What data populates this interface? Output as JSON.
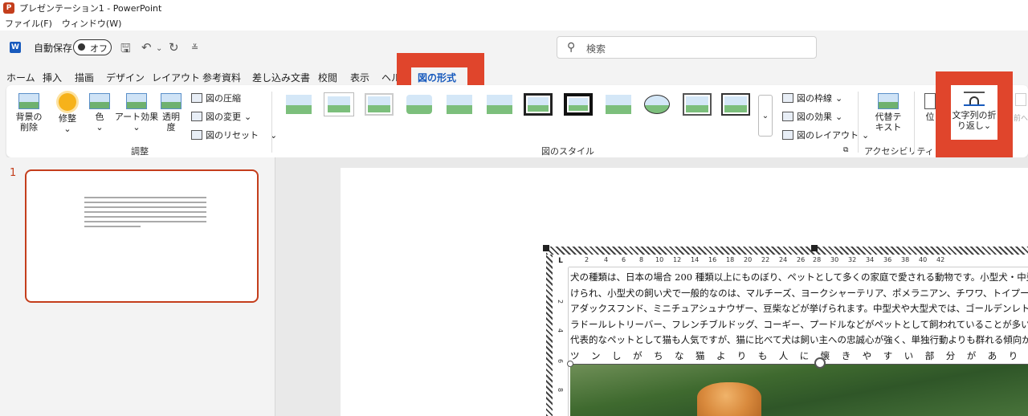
{
  "title_bar": {
    "app_icon": "P",
    "title": "プレゼンテーション1 - PowerPoint"
  },
  "menu": [
    "ファイル(F)",
    "ウィンドウ(W)"
  ],
  "qat": {
    "word_icon": "W",
    "autosave_label": "自動保存",
    "toggle_label": "オフ",
    "icons": [
      "save-icon",
      "undo-icon",
      "redo-icon",
      "customize-icon"
    ]
  },
  "search": {
    "placeholder": "検索"
  },
  "tabs": [
    "ホーム",
    "挿入",
    "描画",
    "デザイン",
    "レイアウト",
    "参考資料",
    "差し込み文書",
    "校閲",
    "表示",
    "ヘル",
    "図の形式"
  ],
  "active_tab": "図の形式",
  "ribbon": {
    "adjust": {
      "remove_bg": "背景の\n削除",
      "corrections": "修整",
      "color": "色",
      "art_effects": "アート効果",
      "transparency": "透明\n度",
      "compress": "図の圧縮",
      "change": "図の変更",
      "reset": "図のリセット",
      "group_label": "調整"
    },
    "styles": {
      "group_label": "図のスタイル",
      "border": "図の枠線",
      "effects": "図の効果",
      "layout": "図のレイアウト"
    },
    "accessibility": {
      "alt_text": "代替テ\nキスト",
      "group_label": "アクセシビリティ"
    },
    "arrange": {
      "position": "位",
      "wrap_text": "文字列の折\nり返し",
      "forward": "前へ"
    }
  },
  "slides_pane": {
    "slide_number": "1"
  },
  "document": {
    "ruler_corner": "L",
    "ruler_ticks": [
      "2",
      "4",
      "6",
      "8",
      "10",
      "12",
      "14",
      "16",
      "18",
      "20",
      "22",
      "24",
      "26",
      "28",
      "30",
      "32",
      "34",
      "36",
      "38",
      "40",
      "42"
    ],
    "ruler_left_ticks": [
      "2",
      "4",
      "6",
      "8"
    ],
    "lines": [
      "犬の種類は、日本の場合 200 種類以上にものぼり、ペットとして多くの家庭で愛される動物です。小型犬・中型犬・",
      "けられ、小型犬の飼い犬で一般的なのは、マルチーズ、ヨークシャーテリア、ポメラニアン、チワワ、トイプードル",
      "アダックスフンド、ミニチュアシュナウザー、豆柴などが挙げられます。中型犬や大型犬では、ゴールデンレトリー",
      "ラドールレトリーバー、フレンチブルドッグ、コーギー、プードルなどがペットとして飼われていることが多いです",
      "代表的なペットとして猫も人気ですが、猫に比べて犬は飼い主への忠誠心が強く、単独行動よりも群れる傾向がある",
      "ツンしがちな猫よりも人に懐きやすい部分があります"
    ]
  }
}
